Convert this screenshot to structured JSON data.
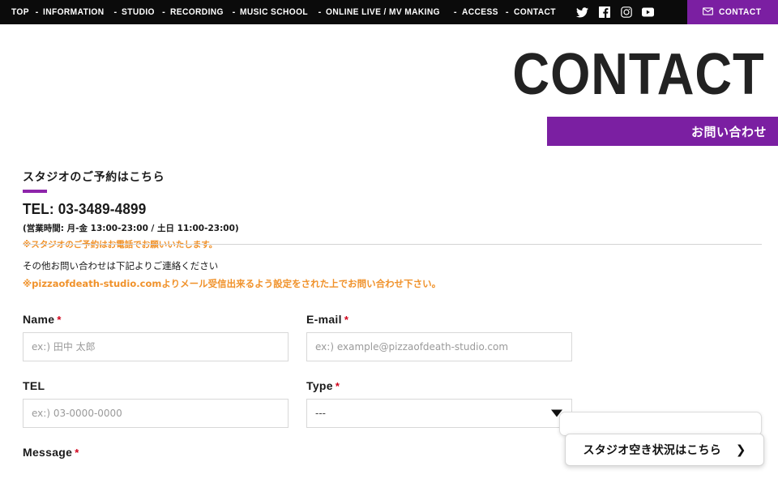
{
  "topbar": {
    "nav_items": [
      {
        "label": "TOP",
        "name": "nav-top"
      },
      {
        "label": "INFORMATION",
        "name": "nav-information"
      },
      {
        "label": "STUDIO",
        "name": "nav-studio"
      },
      {
        "label": "RECORDING",
        "name": "nav-recording"
      },
      {
        "label": "MUSIC SCHOOL",
        "name": "nav-music-school"
      },
      {
        "label": "ONLINE LIVE / MV MAKING",
        "name": "nav-online-live-mv-making"
      },
      {
        "label": "ACCESS",
        "name": "nav-access"
      },
      {
        "label": "CONTACT",
        "name": "nav-contact"
      }
    ],
    "separator": "-",
    "social": [
      {
        "icon": "twitter-icon"
      },
      {
        "icon": "facebook-icon"
      },
      {
        "icon": "instagram-icon"
      },
      {
        "icon": "youtube-icon"
      }
    ],
    "contact_button": {
      "label": "CONTACT",
      "icon": "envelope-icon",
      "background": "#7b1fa2"
    }
  },
  "hero": {
    "title": "CONTACT",
    "band_label": "お問い合わせ",
    "band_color": "#7b1fa2"
  },
  "reservation": {
    "heading": "スタジオのご予約はこちら",
    "accent_color": "#8e24aa",
    "tel": "TEL: 03-3489-4899",
    "hours": "(営業時間: 月-金 13:00-23:00 / 土日 11:00-23:00)",
    "note": "※スタジオのご予約はお電話でお願いいたします。",
    "note_color": "#f0922b"
  },
  "other_contact": {
    "line1": "その他お問い合わせは下記よりご連絡ください",
    "line2": "※pizzaofdeath-studio.comよりメール受信出来るよう設定をされた上でお問い合わせ下さい。",
    "line2_color": "#f0922b"
  },
  "form": {
    "required_mark": "*",
    "fields": {
      "name": {
        "label": "Name",
        "required": true,
        "placeholder": "ex:) 田中 太郎",
        "value": ""
      },
      "email": {
        "label": "E-mail",
        "required": true,
        "placeholder": "ex:) example@pizzaofdeath-studio.com",
        "value": ""
      },
      "tel": {
        "label": "TEL",
        "required": false,
        "placeholder": "ex:) 03-0000-0000",
        "value": ""
      },
      "type": {
        "label": "Type",
        "required": true,
        "selected": "---",
        "options": [
          "---"
        ],
        "arrow_icon": "caret-down-icon"
      },
      "message": {
        "label": "Message",
        "required": true
      }
    }
  },
  "floating": {
    "availability": {
      "label": "スタジオ空き状況はこちら",
      "chevron": "❯"
    }
  }
}
